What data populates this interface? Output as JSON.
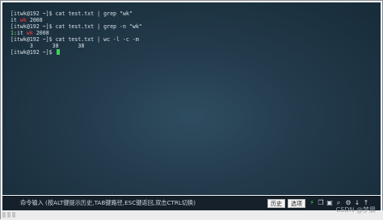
{
  "terminal": {
    "lines": [
      {
        "text": "[itwk@192 ~]$ cat test.txt | grep \"wk\""
      },
      {
        "pre": "it ",
        "highlight": "wk",
        "post": " 2008"
      },
      {
        "text": "[itwk@192 ~]$ cat test.txt | grep -n \"wk\""
      },
      {
        "num": "1",
        "sep": ":",
        "pre": "it ",
        "highlight": "wk",
        "post": " 2008"
      },
      {
        "text": "[itwk@192 ~]$ cat test.txt | wc -l -c -m"
      },
      {
        "text": "      3      38      38"
      },
      {
        "prompt": "[itwk@192 ~]$ "
      }
    ]
  },
  "command_bar": {
    "label": "命令输入 (按ALT键提示历史,TAB键路径,ESC键返回,双击CTRL切换)",
    "history_button": "历史",
    "options_button": "选项",
    "icons": [
      "bolt-icon",
      "copy-icon",
      "paste-icon",
      "search-icon",
      "settings-icon",
      "download-icon",
      "upload-icon"
    ]
  },
  "watermark": "CSDN @梦晨"
}
